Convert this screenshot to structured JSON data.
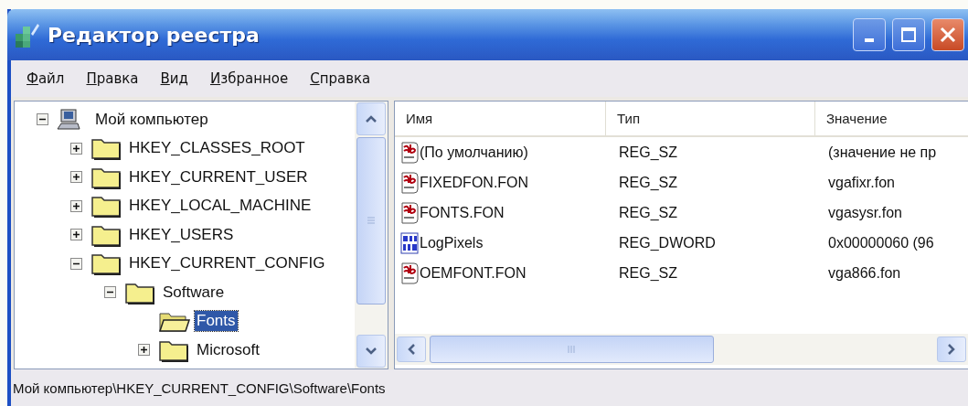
{
  "window": {
    "title": "Редактор реестра"
  },
  "menu": [
    {
      "label": "Файл"
    },
    {
      "label": "Правка"
    },
    {
      "label": "Вид"
    },
    {
      "label": "Избранное"
    },
    {
      "label": "Справка"
    }
  ],
  "tree": [
    {
      "label": "Мой компьютер",
      "kind": "computer",
      "expandable": true,
      "expanded": true,
      "selected": false,
      "children": [
        {
          "label": "HKEY_CLASSES_ROOT",
          "kind": "folder",
          "expandable": true,
          "expanded": false,
          "selected": false
        },
        {
          "label": "HKEY_CURRENT_USER",
          "kind": "folder",
          "expandable": true,
          "expanded": false,
          "selected": false
        },
        {
          "label": "HKEY_LOCAL_MACHINE",
          "kind": "folder",
          "expandable": true,
          "expanded": false,
          "selected": false
        },
        {
          "label": "HKEY_USERS",
          "kind": "folder",
          "expandable": true,
          "expanded": false,
          "selected": false
        },
        {
          "label": "HKEY_CURRENT_CONFIG",
          "kind": "folder",
          "expandable": true,
          "expanded": true,
          "selected": false,
          "children": [
            {
              "label": "Software",
              "kind": "folder",
              "expandable": true,
              "expanded": true,
              "selected": false,
              "children": [
                {
                  "label": "Fonts",
                  "kind": "folder",
                  "expandable": false,
                  "selected": true
                },
                {
                  "label": "Microsoft",
                  "kind": "folder",
                  "expandable": true,
                  "expanded": false,
                  "selected": false
                }
              ]
            }
          ]
        }
      ]
    }
  ],
  "table": {
    "columns": [
      "Имя",
      "Тип",
      "Значение"
    ],
    "rows": [
      {
        "kind": "string",
        "name": "(По умолчанию)",
        "type": "REG_SZ",
        "value": "(значение не пр"
      },
      {
        "kind": "string",
        "name": "FIXEDFON.FON",
        "type": "REG_SZ",
        "value": "vgafixr.fon"
      },
      {
        "kind": "string",
        "name": "FONTS.FON",
        "type": "REG_SZ",
        "value": "vgasysr.fon"
      },
      {
        "kind": "binary",
        "name": "LogPixels",
        "type": "REG_DWORD",
        "value": "0x00000060 (96"
      },
      {
        "kind": "string",
        "name": "OEMFONT.FON",
        "type": "REG_SZ",
        "value": "vga866.fon"
      }
    ]
  },
  "status_bar": "Мой компьютер\\HKEY_CURRENT_CONFIG\\Software\\Fonts"
}
